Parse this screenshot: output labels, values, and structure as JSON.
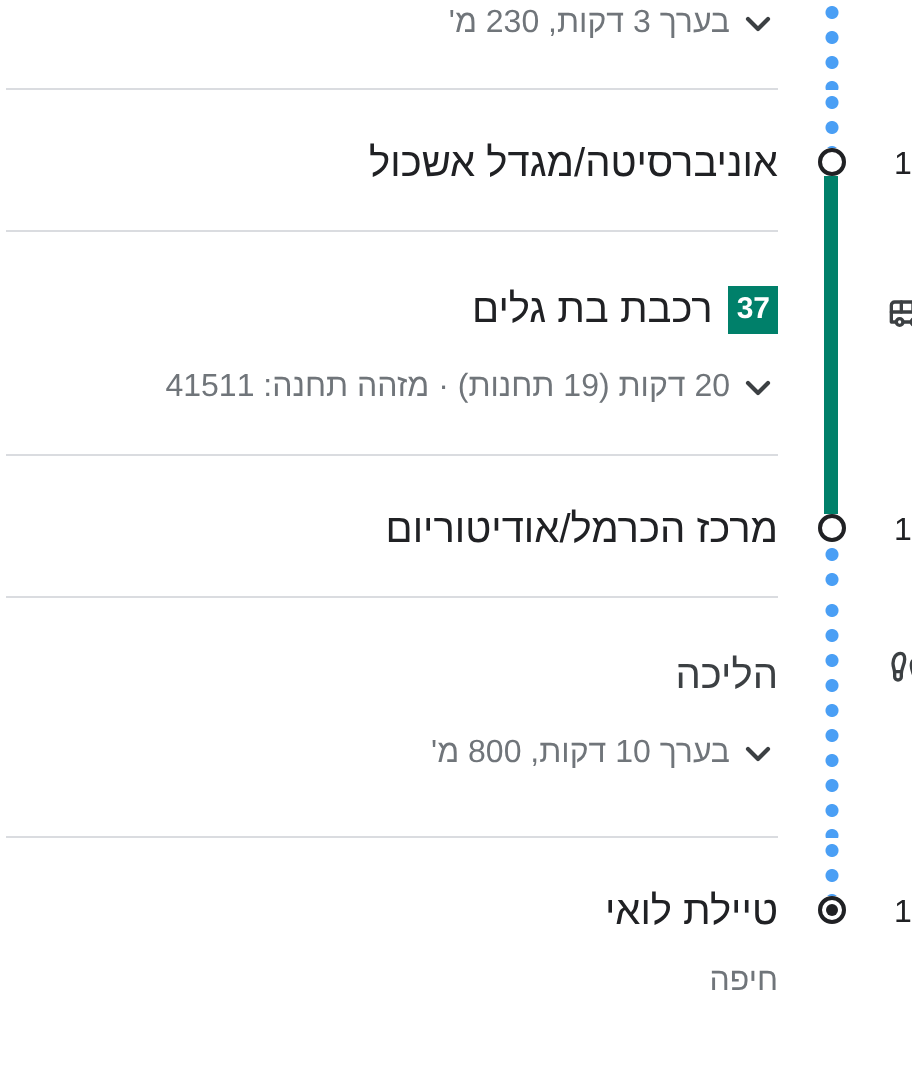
{
  "legs": [
    {
      "kind": "walk",
      "detail": "בערך 3 דקות, 230 מ'"
    },
    {
      "kind": "stop",
      "name": "אוניברסיטה/מגדל אשכול",
      "time": "1"
    },
    {
      "kind": "transit",
      "route": "37",
      "color": "#00806a",
      "name": "רכבת בת גלים",
      "detail": "20 דקות (19 תחנות) · מזהה תחנה: 41511"
    },
    {
      "kind": "stop",
      "name": "מרכז הכרמל/אודיטוריום",
      "time": "1"
    },
    {
      "kind": "walk",
      "title": "הליכה",
      "detail": "בערך 10 דקות, 800 מ'"
    },
    {
      "kind": "destination",
      "name": "טיילת לואי",
      "place": "חיפה",
      "time": "1"
    }
  ]
}
